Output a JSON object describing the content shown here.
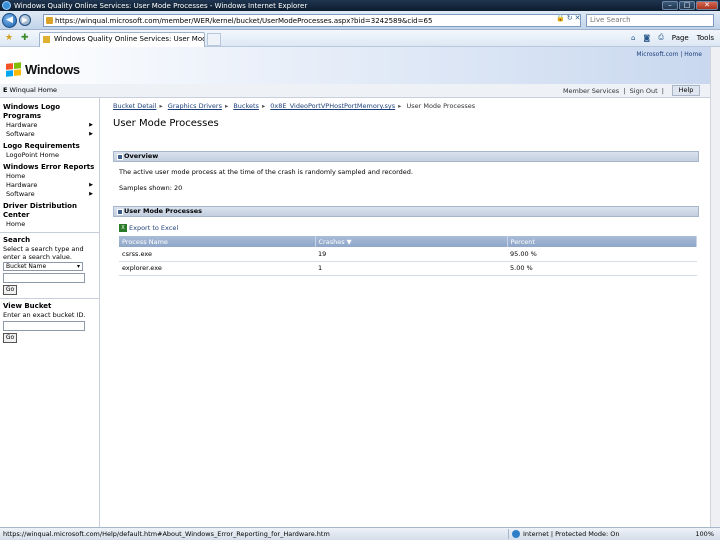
{
  "window": {
    "title": "Windows Quality Online Services: User Mode Processes - Windows Internet Explorer"
  },
  "addressbar": {
    "url": "https://winqual.microsoft.com/member/WER/kernel/bucket/UserModeProcesses.aspx?bid=3242589&cid=65",
    "search_placeholder": "Live Search"
  },
  "tab": {
    "label": "Windows Quality Online Services: User Mode Pro..."
  },
  "commandbar": {
    "page": "Page",
    "tools": "Tools"
  },
  "banner": {
    "brand": "Windows",
    "toplinks": "Microsoft.com | Home"
  },
  "header": {
    "home_prefix": "E",
    "home_label": "Winqual Home",
    "member_services": "Member Services",
    "sign_out": "Sign Out",
    "help": "Help"
  },
  "leftnav": {
    "logo_programs": "Windows Logo Programs",
    "hardware": "Hardware",
    "software": "Software",
    "logo_requirements": "Logo Requirements",
    "logopoint_home": "LogoPoint Home",
    "error_reports": "Windows Error Reports",
    "wer_home": "Home",
    "wer_hardware": "Hardware",
    "wer_software": "Software",
    "driver_center": "Driver Distribution Center",
    "ddc_home": "Home",
    "search_heading": "Search",
    "search_help": "Select a search type and enter a search value.",
    "search_type": "Bucket Name",
    "go": "Go",
    "view_bucket": "View Bucket",
    "view_bucket_help": "Enter an exact bucket ID.",
    "go2": "Go"
  },
  "main": {
    "breadcrumbs": [
      "Bucket Detail",
      "Graphics Drivers",
      "Buckets",
      "0x8E_VideoPortVPHostPortMemory.sys"
    ],
    "breadcrumb_current": "User Mode Processes",
    "title": "User Mode Processes",
    "overview_heading": "Overview",
    "overview_text": "The active user mode process at the time of the crash is randomly sampled and recorded.",
    "samples_label": "Samples shown:",
    "samples_value": "20",
    "processes_heading": "User Mode Processes",
    "export": "Export to Excel",
    "columns": [
      "Process Name",
      "Crashes ▼",
      "Percent"
    ],
    "rows": [
      [
        "csrss.exe",
        "19",
        "95.00 %"
      ],
      [
        "explorer.exe",
        "1",
        "5.00 %"
      ]
    ]
  },
  "statusbar": {
    "url": "https://winqual.microsoft.com/Help/default.htm#About_Windows_Error_Reporting_for_Hardware.htm",
    "zone": "Internet | Protected Mode: On",
    "zoom": "100%"
  }
}
